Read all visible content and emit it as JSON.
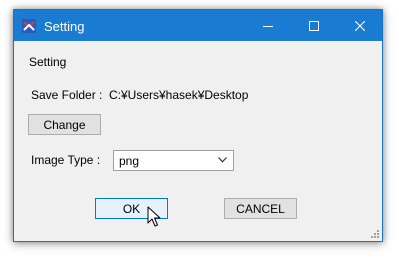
{
  "window": {
    "title": "Setting",
    "controls": {
      "minimize": "minimize-icon",
      "maximize": "maximize-icon",
      "close": "close-icon"
    }
  },
  "content": {
    "section_label": "Setting",
    "save_folder_label": "Save Folder :",
    "save_folder_value": "C:¥Users¥hasek¥Desktop",
    "change_button": "Change",
    "image_type_label": "Image Type :",
    "image_type_value": "png",
    "ok_button": "OK",
    "cancel_button": "CANCEL"
  },
  "colors": {
    "titlebar": "#1a7bd3",
    "window_bg": "#f0f0f0",
    "default_button_border": "#0078d7"
  }
}
